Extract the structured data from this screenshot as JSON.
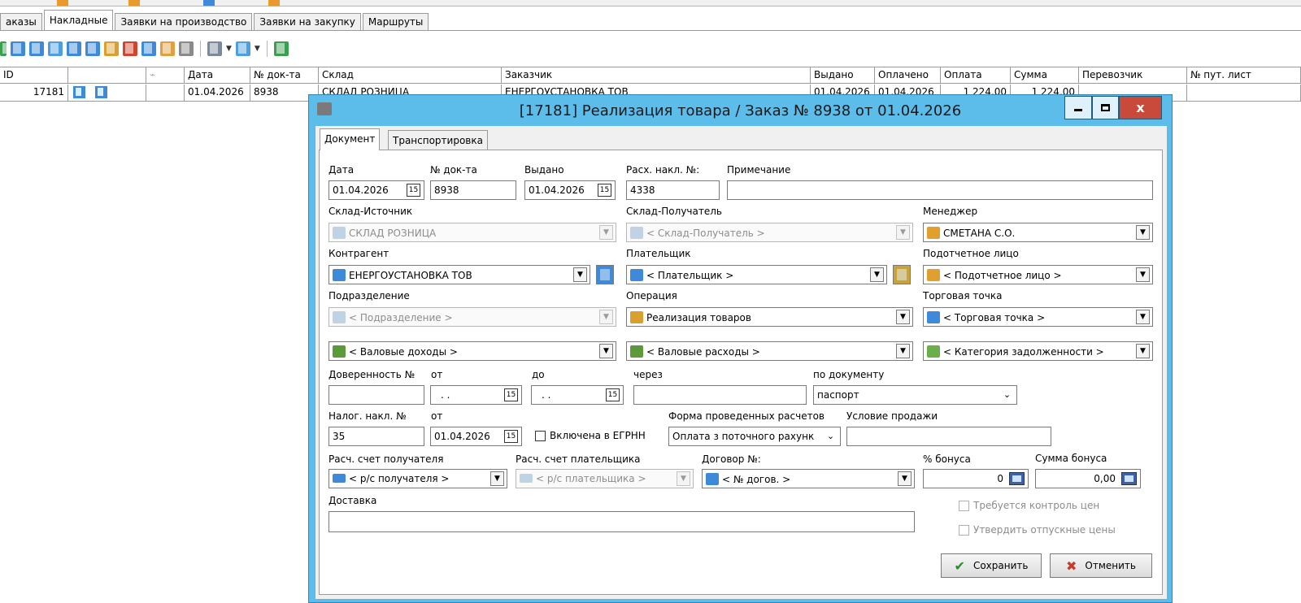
{
  "main_tabs": [
    {
      "label": "аказы"
    },
    {
      "label": "Накладные"
    },
    {
      "label": "Заявки на производство"
    },
    {
      "label": "Заявки на закупку"
    },
    {
      "label": "Маршруты"
    }
  ],
  "grid": {
    "headers": [
      "ID",
      "",
      "",
      "Дата",
      "№ док-та",
      "Склад",
      "Заказчик",
      "Выдано",
      "Оплачено",
      "Оплата",
      "Сумма",
      "Перевозчик",
      "№ пут. лист"
    ],
    "row": {
      "id": "17181",
      "date": "01.04.2026",
      "doc_no": "8938",
      "warehouse": "СКЛАД РОЗНИЦА",
      "customer": "ЕНЕРГОУСТАНОВКА ТОВ",
      "issued": "01.04.2026",
      "paid": "01.04.2026",
      "payment": "1 224,00",
      "sum": "1 224,00"
    }
  },
  "dialog": {
    "title": "[17181] Реализация товара  / Заказ № 8938 от 01.04.2026",
    "close_glyph": "x",
    "tabs": [
      "Документ",
      "Транспортировка"
    ],
    "form": {
      "date_label": "Дата",
      "date_value": "01.04.2026",
      "docno_label": "№ док-та",
      "docno_value": "8938",
      "issued_label": "Выдано",
      "issued_value": "01.04.2026",
      "exp_label": "Расх. накл. №:",
      "exp_value": "4338",
      "note_label": "Примечание",
      "note_value": "",
      "src_label": "Склад-Источник",
      "src_value": "СКЛАД РОЗНИЦА",
      "dst_label": "Склад-Получатель",
      "dst_value": "< Склад-Получатель >",
      "manager_label": "Менеджер",
      "manager_value": "СМЕТАНА  С.О.",
      "contragent_label": "Контрагент",
      "contragent_value": "ЕНЕРГОУСТАНОВКА ТОВ",
      "payer_label": "Плательщик",
      "payer_value": "< Плательщик >",
      "acc_person_label": "Подотчетное лицо",
      "acc_person_value": "< Подотчетное лицо >",
      "division_label": "Подразделение",
      "division_value": "< Подразделение >",
      "operation_label": "Операция",
      "operation_value": "Реализация товаров",
      "outlet_label": "Торговая точка",
      "outlet_value": "< Торговая точка >",
      "gross_income_value": "< Валовые доходы >",
      "gross_expense_value": "< Валовые расходы >",
      "debt_cat_value": "< Категория задолженности >",
      "proxy_label": "Доверенность №",
      "from_label": "от",
      "to_label": "до",
      "via_label": "через",
      "bydoc_label": "по документу",
      "proxy_from_value": ". .",
      "proxy_to_value": ". .",
      "bydoc_value": "паспорт",
      "tax_label": "Налог. накл. №",
      "tax_value": "35",
      "tax_from_label": "от",
      "tax_date_value": "01.04.2026",
      "egrn_label": "Включена в ЕГРНН",
      "payform_label": "Форма проведенных расчетов",
      "payform_value": "Оплата з поточного рахунк",
      "sale_cond_label": "Условие продажи",
      "sale_cond_value": "",
      "recv_acc_label": "Расч. счет получателя",
      "recv_acc_value": "< р/с получателя >",
      "payer_acc_label": "Расч. счет плательщика",
      "payer_acc_value": "< р/с плательщика >",
      "contract_label": "Договор №:",
      "contract_value": "< № догов. >",
      "bonus_pct_label": "% бонуса",
      "bonus_pct_value": "0",
      "bonus_sum_label": "Сумма бонуса",
      "bonus_sum_value": "0,00",
      "delivery_label": "Доставка",
      "delivery_value": "",
      "price_ctrl_label": "Требуется контроль цен",
      "approve_prices_label": "Утвердить отпускные цены",
      "cal_glyph": "15",
      "dd_glyph": "▼",
      "dd_flat_glyph": "⌄"
    },
    "buttons": {
      "save": "Сохранить",
      "cancel": "Отменить"
    }
  }
}
